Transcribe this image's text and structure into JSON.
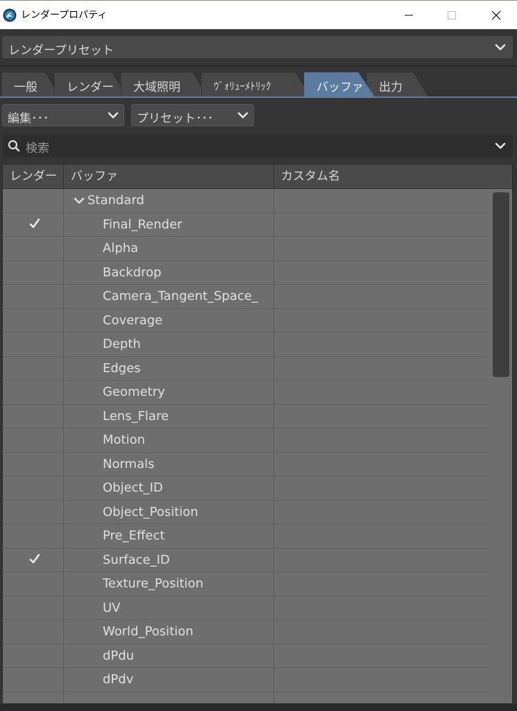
{
  "window": {
    "title": "レンダープロパティ",
    "min_glyph": "—",
    "max_glyph": "☐",
    "close_glyph": "✕"
  },
  "preset": {
    "label": "レンダープリセット"
  },
  "tabs": [
    {
      "label": "一般",
      "active": false
    },
    {
      "label": "レンダー",
      "active": false
    },
    {
      "label": "大域照明",
      "active": false
    },
    {
      "label": "ｳﾞｫﾘｭｰﾒﾄﾘｯｸ",
      "active": false
    },
    {
      "label": "バッファ",
      "active": true
    },
    {
      "label": "出力",
      "active": false
    }
  ],
  "toolbar": {
    "edit_label": "編集･･･",
    "preset_label": "プリセット･･･"
  },
  "search": {
    "placeholder": "検索"
  },
  "table": {
    "columns": [
      "レンダー",
      "バッファ",
      "カスタム名"
    ],
    "group": "Standard",
    "rows": [
      {
        "name": "Final_Render",
        "render": true
      },
      {
        "name": "Alpha",
        "render": false
      },
      {
        "name": "Backdrop",
        "render": false
      },
      {
        "name": "Camera_Tangent_Space_",
        "render": false
      },
      {
        "name": "Coverage",
        "render": false
      },
      {
        "name": "Depth",
        "render": false
      },
      {
        "name": "Edges",
        "render": false
      },
      {
        "name": "Geometry",
        "render": false
      },
      {
        "name": "Lens_Flare",
        "render": false
      },
      {
        "name": "Motion",
        "render": false
      },
      {
        "name": "Normals",
        "render": false
      },
      {
        "name": "Object_ID",
        "render": false
      },
      {
        "name": "Object_Position",
        "render": false
      },
      {
        "name": "Pre_Effect",
        "render": false
      },
      {
        "name": "Surface_ID",
        "render": true
      },
      {
        "name": "Texture_Position",
        "render": false
      },
      {
        "name": "UV",
        "render": false
      },
      {
        "name": "World_Position",
        "render": false
      },
      {
        "name": "dPdu",
        "render": false
      },
      {
        "name": "dPdv",
        "render": false
      }
    ]
  },
  "colors": {
    "active_tab": "#5b7ba1",
    "inactive_tab": "#484848",
    "table_bg": "#6e6e6e"
  },
  "icons": {
    "app": "render-app-icon",
    "search": "search-icon",
    "dropdown": "chevron-down-icon",
    "check": "checkmark-icon",
    "group": "chevron-down-icon"
  }
}
